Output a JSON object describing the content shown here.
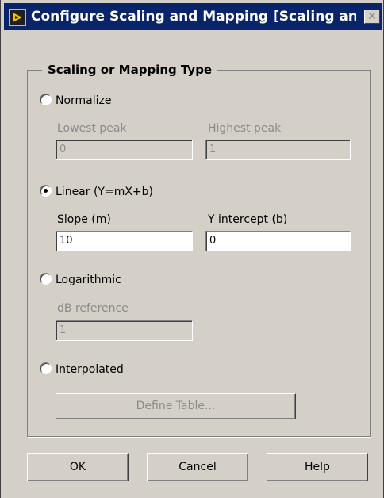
{
  "window": {
    "title": "Configure Scaling and Mapping [Scaling and ...",
    "close_glyph": "✕",
    "title_bar_color": "#0a246a",
    "face_color": "#d4d0c8"
  },
  "group": {
    "label": "Scaling or Mapping Type"
  },
  "normalize": {
    "label": "Normalize",
    "selected": false,
    "lowest_label": "Lowest peak",
    "lowest_value": "0",
    "highest_label": "Highest peak",
    "highest_value": "1"
  },
  "linear": {
    "label": "Linear (Y=mX+b)",
    "selected": true,
    "slope_label": "Slope (m)",
    "slope_value": "10",
    "intercept_label": "Y intercept (b)",
    "intercept_value": "0"
  },
  "logarithmic": {
    "label": "Logarithmic",
    "selected": false,
    "db_label": "dB reference",
    "db_value": "1"
  },
  "interpolated": {
    "label": "Interpolated",
    "selected": false,
    "define_table_label": "Define Table..."
  },
  "buttons": {
    "ok": "OK",
    "cancel": "Cancel",
    "help": "Help"
  }
}
